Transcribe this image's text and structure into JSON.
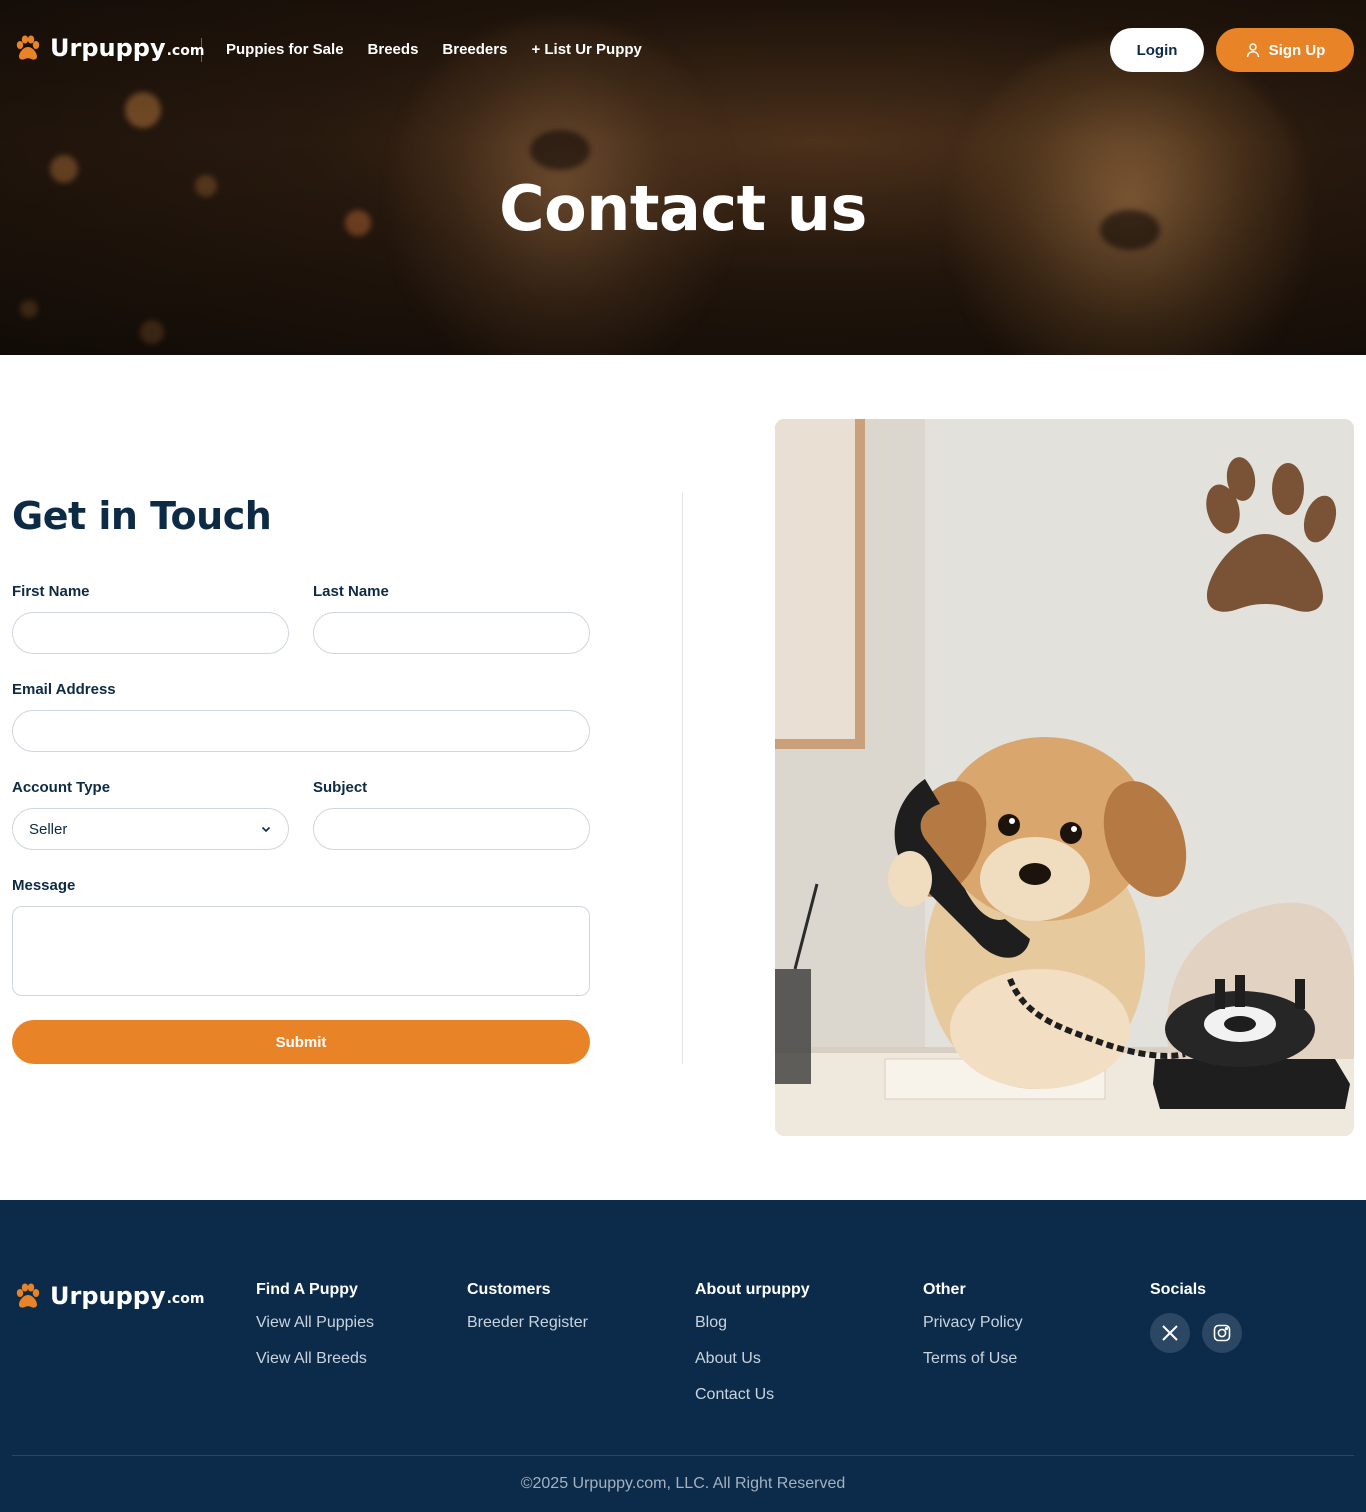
{
  "brand": {
    "name": "Urpuppy",
    "tld": ".com",
    "accent": "#e88427",
    "navy": "#0c2b4b"
  },
  "nav": {
    "links": [
      "Puppies for Sale",
      "Breeds",
      "Breeders",
      "+ List Ur Puppy"
    ],
    "login_label": "Login",
    "signup_label": "Sign Up"
  },
  "hero": {
    "title": "Contact us"
  },
  "form": {
    "heading": "Get in Touch",
    "first_name_label": "First Name",
    "first_name_value": "",
    "last_name_label": "Last Name",
    "last_name_value": "",
    "email_label": "Email Address",
    "email_value": "",
    "account_type_label": "Account Type",
    "account_type_value": "Seller",
    "subject_label": "Subject",
    "subject_value": "",
    "message_label": "Message",
    "message_value": "",
    "submit_label": "Submit"
  },
  "footer": {
    "columns": [
      {
        "title": "Find A Puppy",
        "links": [
          "View All Puppies",
          "View All Breeds"
        ]
      },
      {
        "title": "Customers",
        "links": [
          "Breeder Register"
        ]
      },
      {
        "title": "About urpuppy",
        "links": [
          "Blog",
          "About Us",
          "Contact Us"
        ]
      },
      {
        "title": "Other",
        "links": [
          "Privacy Policy",
          "Terms of Use"
        ]
      }
    ],
    "socials_title": "Socials",
    "socials": [
      "x-icon",
      "instagram-icon"
    ],
    "copyright": "©2025 Urpuppy.com, LLC. All Right Reserved"
  }
}
